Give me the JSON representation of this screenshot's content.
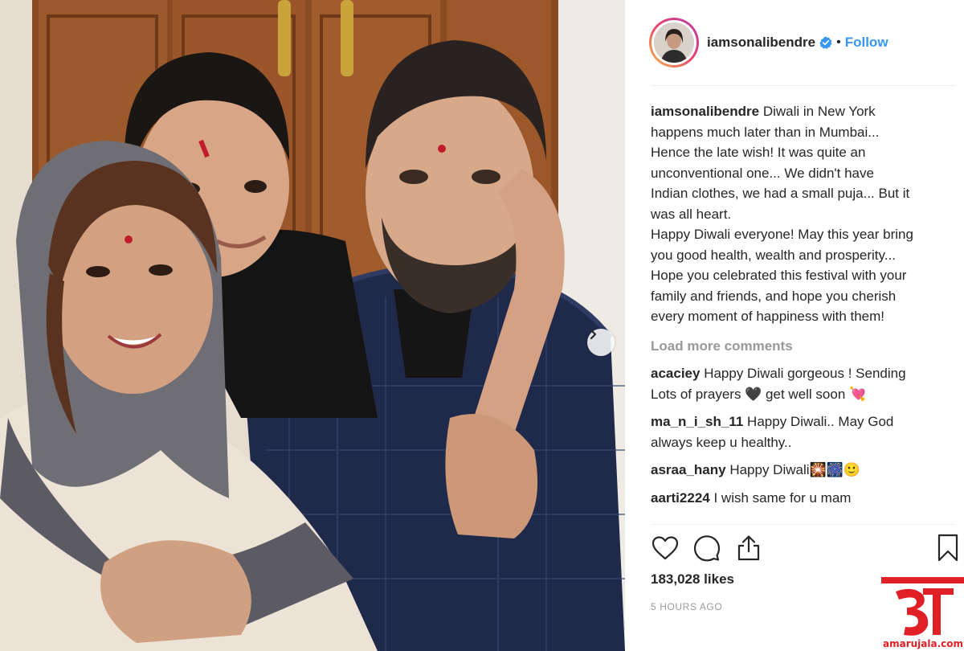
{
  "post": {
    "username": "iamsonalibendre",
    "follow_label": "Follow",
    "separator": "•"
  },
  "caption": {
    "username": "iamsonalibendre",
    "lines": [
      "Diwali in New York",
      "happens much later than in Mumbai...",
      "Hence the late wish! It was quite an",
      "unconventional one... We didn't have",
      "Indian clothes, we had a small puja... But it",
      "was all heart.",
      "Happy Diwali everyone! May this year bring",
      "you good health, wealth and prosperity...",
      "Hope you celebrated this festival with your",
      "family and friends, and hope you cherish",
      "every moment of happiness with them!"
    ]
  },
  "load_more_label": "Load more comments",
  "comments": [
    {
      "username": "acaciey",
      "lines": [
        "Happy Diwali gorgeous ! Sending",
        "Lots of prayers 🖤 get well soon 💘"
      ]
    },
    {
      "username": "ma_n_i_sh_11",
      "lines": [
        "Happy Diwali.. May God",
        "always keep u healthy.."
      ]
    },
    {
      "username": "asraa_hany",
      "lines": [
        "Happy Diwali🎇🎆🙂"
      ]
    },
    {
      "username": "aarti2224",
      "lines": [
        "I wish same for u mam"
      ]
    }
  ],
  "likes": "183,028 likes",
  "timestamp": "5 HOURS AGO",
  "icons": {
    "like": "heart-icon",
    "comment": "comment-icon",
    "share": "share-icon",
    "save": "bookmark-icon",
    "verified": "verified-badge-icon",
    "next": "chevron-right-icon"
  },
  "colors": {
    "link": "#3897f0",
    "muted": "#999999",
    "text": "#262626",
    "watermark": "#e01f26"
  },
  "watermark": {
    "glyph": "अ",
    "site": "amarujala.com"
  }
}
